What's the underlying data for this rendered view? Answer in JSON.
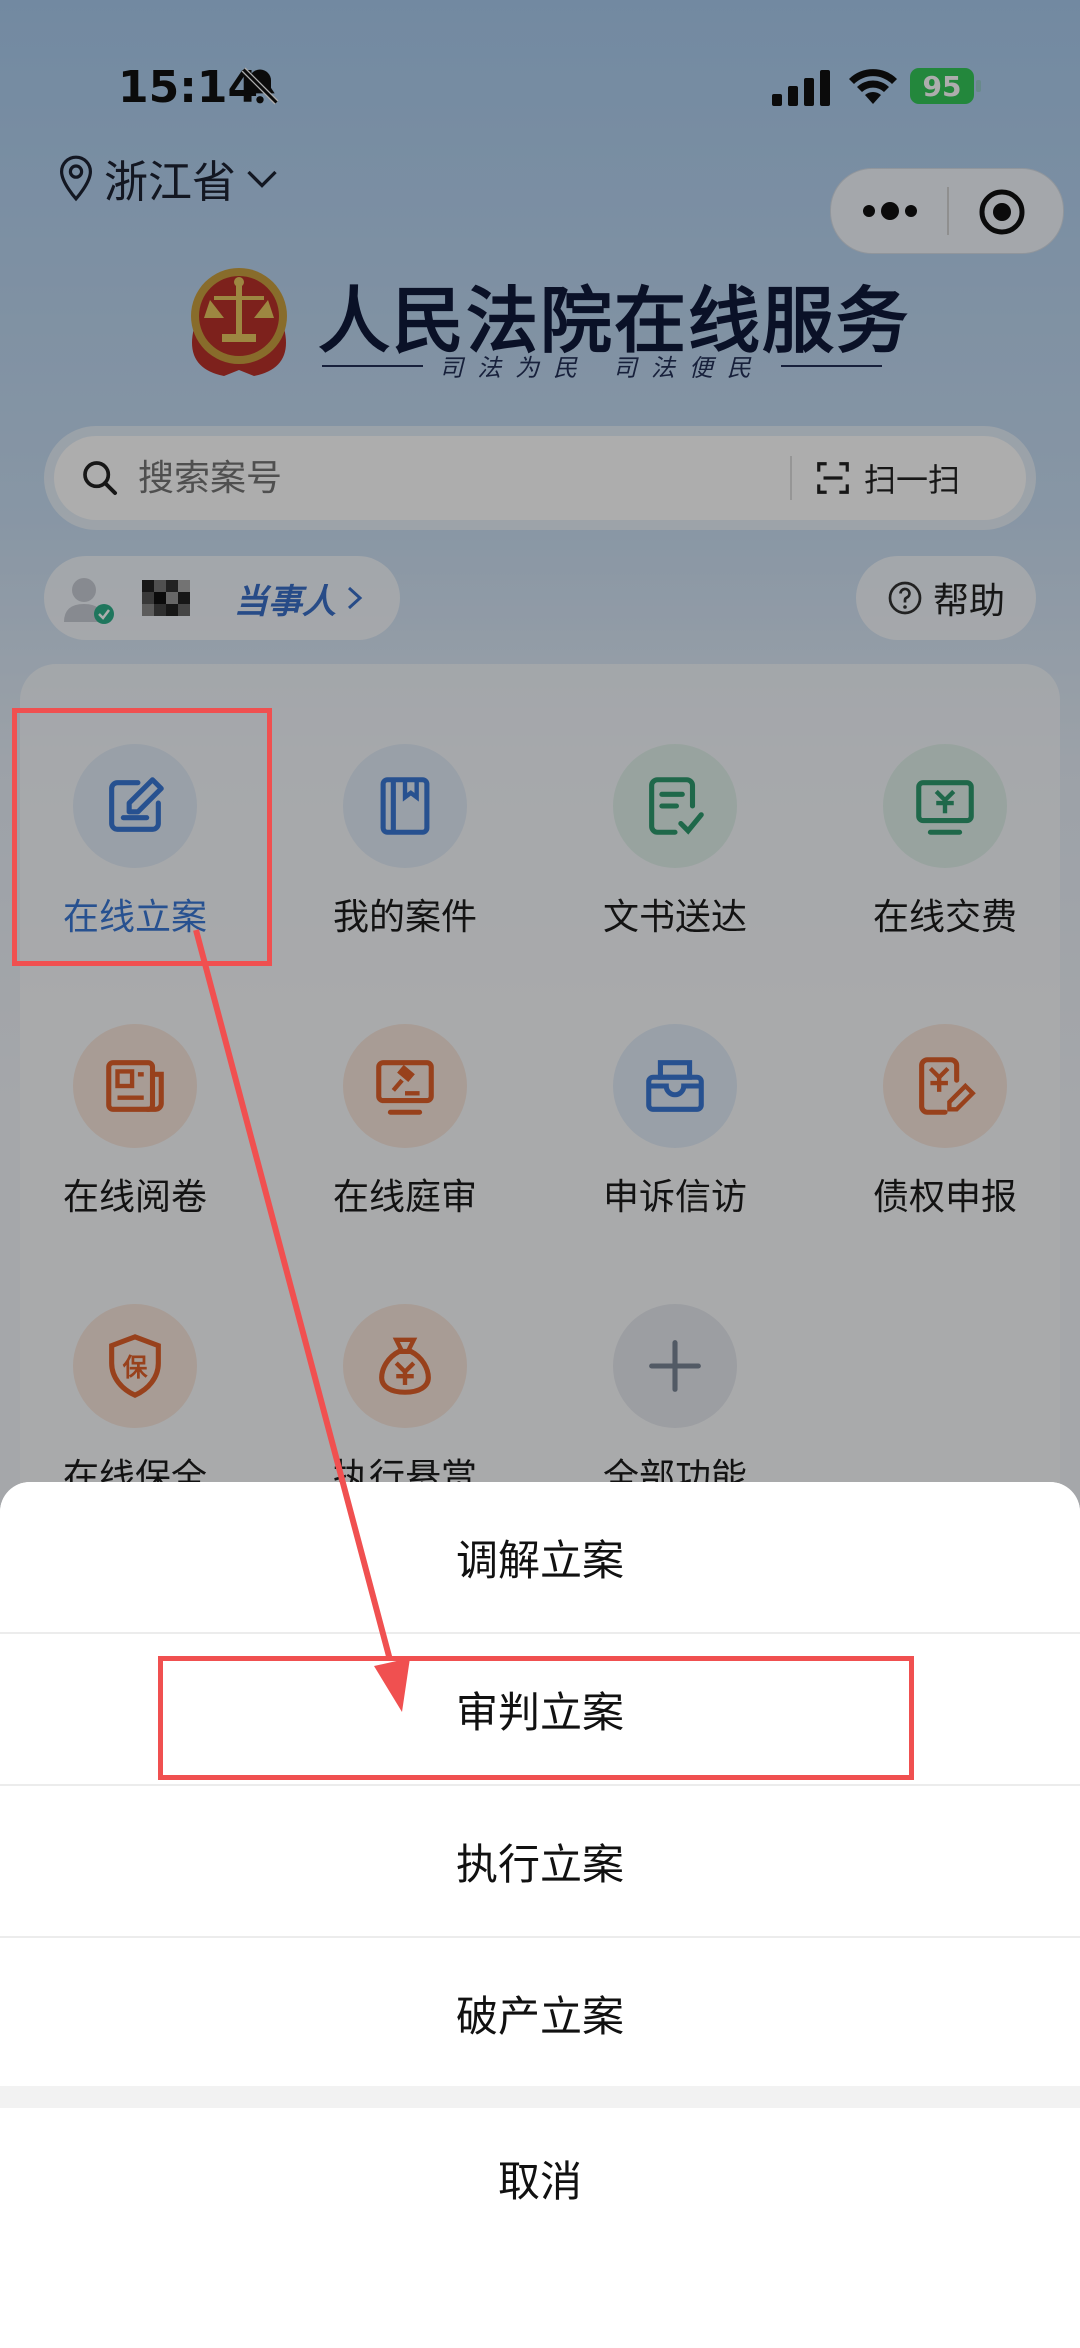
{
  "status_bar": {
    "time": "15:14",
    "battery": "95"
  },
  "location": {
    "label": "浙江省"
  },
  "header": {
    "title": "人民法院在线服务",
    "slogan": "司法为民 司法便民"
  },
  "search": {
    "placeholder": "搜索案号",
    "scan_label": "扫一扫"
  },
  "user": {
    "role_label": "当事人"
  },
  "help": {
    "label": "帮助"
  },
  "functions": [
    {
      "label": "在线立案",
      "icon": "edit-square-icon"
    },
    {
      "label": "我的案件",
      "icon": "book-icon"
    },
    {
      "label": "文书送达",
      "icon": "document-check-icon"
    },
    {
      "label": "在线交费",
      "icon": "monitor-yen-icon"
    },
    {
      "label": "在线阅卷",
      "icon": "newspaper-icon"
    },
    {
      "label": "在线庭审",
      "icon": "gavel-screen-icon"
    },
    {
      "label": "申诉信访",
      "icon": "mailbox-icon"
    },
    {
      "label": "债权申报",
      "icon": "yen-document-icon"
    },
    {
      "label": "在线保全",
      "icon": "shield-bao-icon"
    },
    {
      "label": "执行悬赏",
      "icon": "money-bag-icon"
    },
    {
      "label": "全部功能",
      "icon": "plus-icon"
    }
  ],
  "action_sheet": {
    "items": [
      "调解立案",
      "审判立案",
      "执行立案",
      "破产立案"
    ],
    "cancel": "取消"
  },
  "colors": {
    "accent_blue": "#3a78d4",
    "annotation_red": "#f05050",
    "battery_green": "#34c759",
    "orange_icon": "#e0602a",
    "green_icon": "#2f9a6e"
  }
}
